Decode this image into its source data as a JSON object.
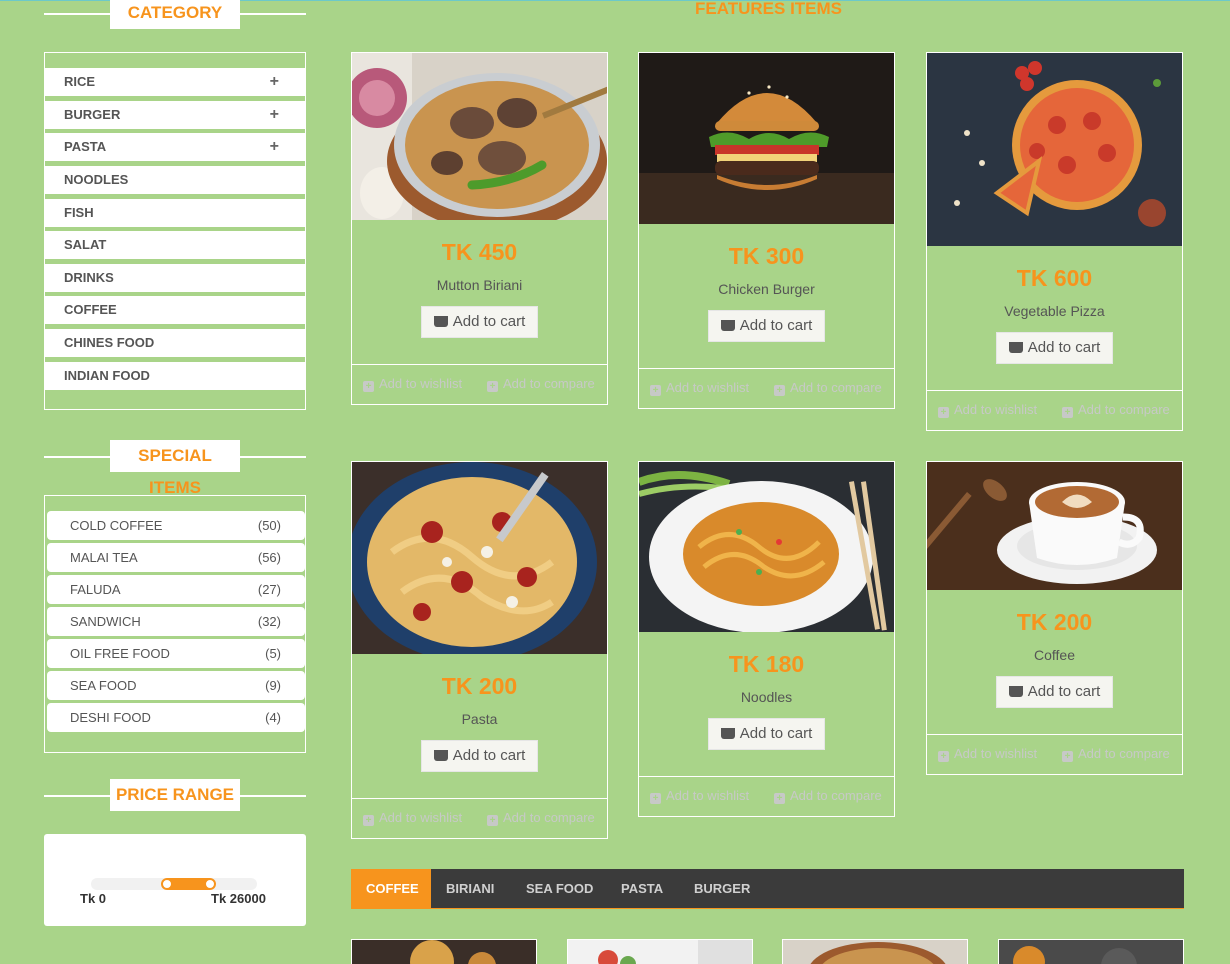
{
  "sidebar": {
    "category_title": "CATEGORY",
    "categories": [
      {
        "label": "RICE",
        "expand": "+"
      },
      {
        "label": "BURGER",
        "expand": "+"
      },
      {
        "label": "PASTA",
        "expand": "+"
      },
      {
        "label": "NOODLES"
      },
      {
        "label": "FISH"
      },
      {
        "label": "SALAT"
      },
      {
        "label": "DRINKS"
      },
      {
        "label": "COFFEE"
      },
      {
        "label": "CHINES FOOD"
      },
      {
        "label": "INDIAN FOOD"
      }
    ],
    "special_title": "SPECIAL ITEMS",
    "special_items": [
      {
        "label": "COLD COFFEE",
        "count": "(50)"
      },
      {
        "label": "MALAI TEA",
        "count": "(56)"
      },
      {
        "label": "FALUDA",
        "count": "(27)"
      },
      {
        "label": "SANDWICH",
        "count": "(32)"
      },
      {
        "label": "OIL FREE FOOD",
        "count": "(5)"
      },
      {
        "label": "SEA FOOD",
        "count": "(9)"
      },
      {
        "label": "DESHI FOOD",
        "count": "(4)"
      }
    ],
    "price_title": "PRICE RANGE",
    "price_min_label": "Tk 0",
    "price_max_label": "Tk 26000",
    "price_slider": {
      "min_fraction": 0.42,
      "max_fraction": 0.75
    }
  },
  "features": {
    "title": "FEATURES ITEMS",
    "add_to_cart_label": "Add to cart",
    "wishlist_label": "Add to wishlist",
    "compare_label": "Add to compare",
    "products": [
      {
        "price": "TK 450",
        "name": "Mutton Biriani",
        "image": "biriani"
      },
      {
        "price": "TK 300",
        "name": "Chicken Burger",
        "image": "burger"
      },
      {
        "price": "TK 600",
        "name": "Vegetable Pizza",
        "image": "pizza"
      },
      {
        "price": "TK 200",
        "name": "Pasta",
        "image": "pasta"
      },
      {
        "price": "TK 180",
        "name": "Noodles",
        "image": "noodles"
      },
      {
        "price": "TK 200",
        "name": "Coffee",
        "image": "coffee"
      }
    ]
  },
  "tabs": {
    "items": [
      "COFFEE",
      "BIRIANI",
      "SEA FOOD",
      "PASTA",
      "BURGER"
    ],
    "active": "COFFEE"
  },
  "colors": {
    "accent": "#f7941d",
    "background": "#a9d489",
    "tabbar": "#3b3b3b"
  }
}
